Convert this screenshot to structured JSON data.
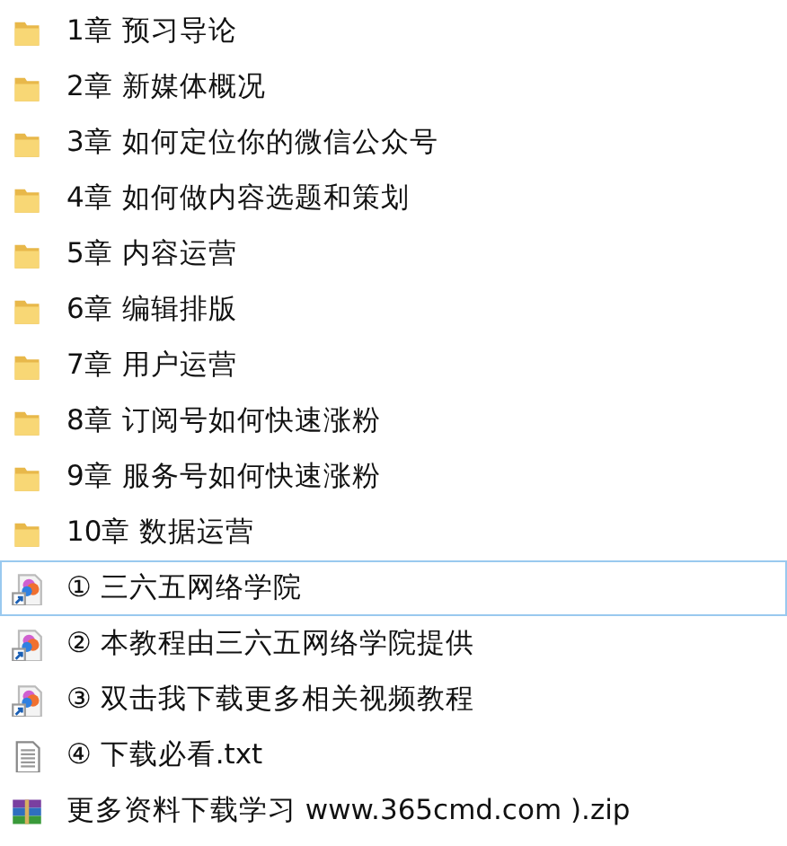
{
  "files": [
    {
      "kind": "folder",
      "name": "1章 预习导论",
      "focused": false
    },
    {
      "kind": "folder",
      "name": "2章 新媒体概况",
      "focused": false
    },
    {
      "kind": "folder",
      "name": "3章 如何定位你的微信公众号",
      "focused": false
    },
    {
      "kind": "folder",
      "name": "4章 如何做内容选题和策划",
      "focused": false
    },
    {
      "kind": "folder",
      "name": "5章 内容运营",
      "focused": false
    },
    {
      "kind": "folder",
      "name": "6章 编辑排版",
      "focused": false
    },
    {
      "kind": "folder",
      "name": "7章 用户运营",
      "focused": false
    },
    {
      "kind": "folder",
      "name": "8章 订阅号如何快速涨粉",
      "focused": false
    },
    {
      "kind": "folder",
      "name": "9章 服务号如何快速涨粉",
      "focused": false
    },
    {
      "kind": "folder",
      "name": "10章 数据运营",
      "focused": false
    },
    {
      "kind": "shortcut",
      "name": "① 三六五网络学院",
      "focused": true
    },
    {
      "kind": "shortcut",
      "name": "② 本教程由三六五网络学院提供",
      "focused": false
    },
    {
      "kind": "shortcut",
      "name": "③ 双击我下载更多相关视频教程",
      "focused": false
    },
    {
      "kind": "text",
      "name": "④ 下载必看.txt",
      "focused": false
    },
    {
      "kind": "archive",
      "name": "更多资料下载学习 www.365cmd.com ).zip",
      "focused": false
    }
  ]
}
